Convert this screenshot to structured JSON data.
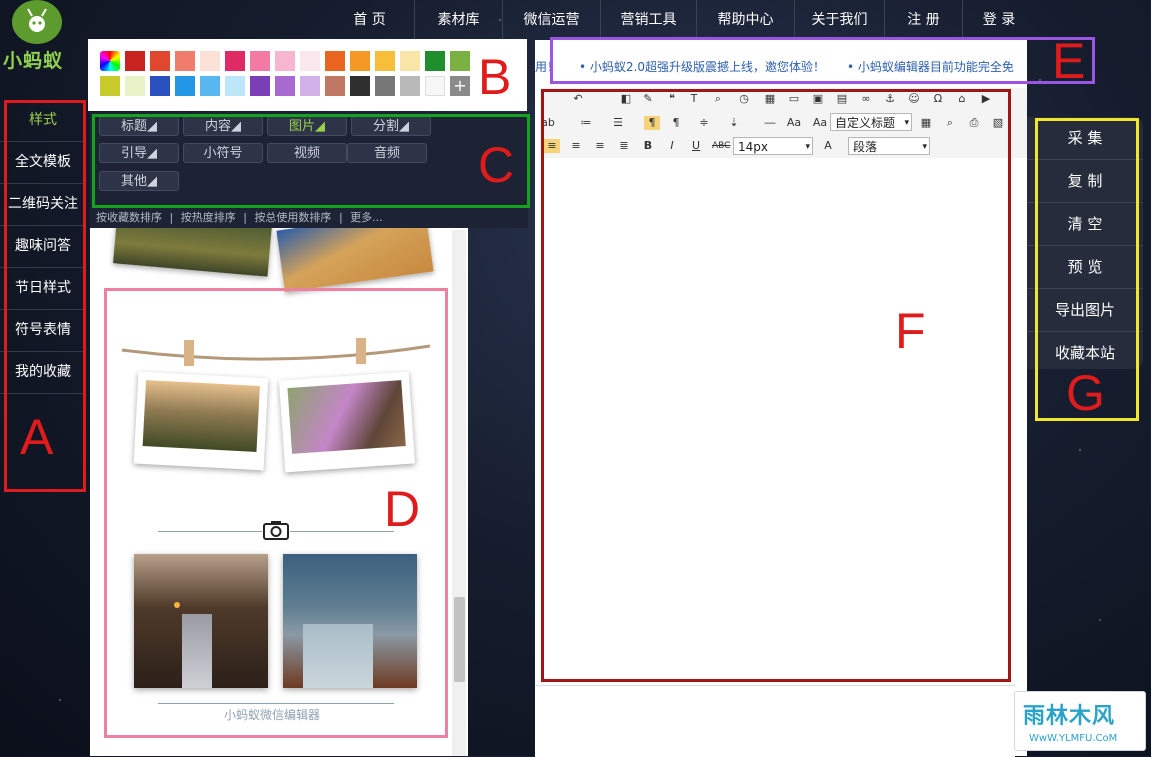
{
  "logo": {
    "text": "小蚂蚁"
  },
  "topnav": [
    "首 页",
    "素材库",
    "微信运营",
    "营销工具",
    "帮助中心",
    "关于我们",
    "注 册",
    "登 录"
  ],
  "sidebar": [
    "样式",
    "全文模板",
    "二维码关注",
    "趣味问答",
    "节日样式",
    "符号表情",
    "我的收藏"
  ],
  "palette": [
    "#c8231f",
    "#e0472f",
    "#f07c6e",
    "#fbe1d8",
    "#e02a64",
    "#f27aa3",
    "#f7b6cf",
    "#fbe7ee",
    "#e8641f",
    "#f49a24",
    "#f7be3b",
    "#f9e5a8",
    "#1f8f2e",
    "#7bb042",
    "#c8c92a",
    "#e8f2c7",
    "#2a4fbf",
    "#2396e6",
    "#58b7f0",
    "#bde6f8",
    "#7a3fb7",
    "#a86ad1",
    "#d2b1e9",
    "#c07864",
    "#2f2f2f",
    "#777777",
    "#b9b9b9",
    "#f6f6f6"
  ],
  "categories": [
    "标题◢",
    "内容◢",
    "图片◢",
    "分割◢",
    "引导◢",
    "小符号",
    "视频",
    "音频",
    "其他◢"
  ],
  "sort_links": [
    "按收藏数排序",
    "|",
    "按热度排序",
    "|",
    "按总使用数排序",
    "|",
    "更多..."
  ],
  "preview": {
    "caption": "小蚂蚁微信编辑器"
  },
  "marquee": [
    "用！",
    "• 小蚂蚁2.0超强升级版震撼上线，邀您体验！",
    "• 小蚂蚁编辑器目前功能完全免"
  ],
  "toolbar": {
    "heading_select": "自定义标题",
    "font_size": "14px",
    "paragraph_select": "段落"
  },
  "actions": [
    "采 集",
    "复 制",
    "清 空",
    "预 览",
    "导出图片",
    "收藏本站"
  ],
  "annotations": {
    "A": "A",
    "B": "B",
    "C": "C",
    "D": "D",
    "E": "E",
    "F": "F",
    "G": "G"
  },
  "watermark": {
    "big": "雨林木风",
    "small": "WwW.YLMFU.CoM"
  },
  "colors": {
    "brand_green": "#8fd14f",
    "annot_red": "#e01b1b",
    "annot_green": "#13a31c",
    "annot_pink": "#ee80a2",
    "annot_purple": "#9a56e3",
    "annot_yellow": "#f2e62a",
    "annot_darkred": "#a01616"
  }
}
